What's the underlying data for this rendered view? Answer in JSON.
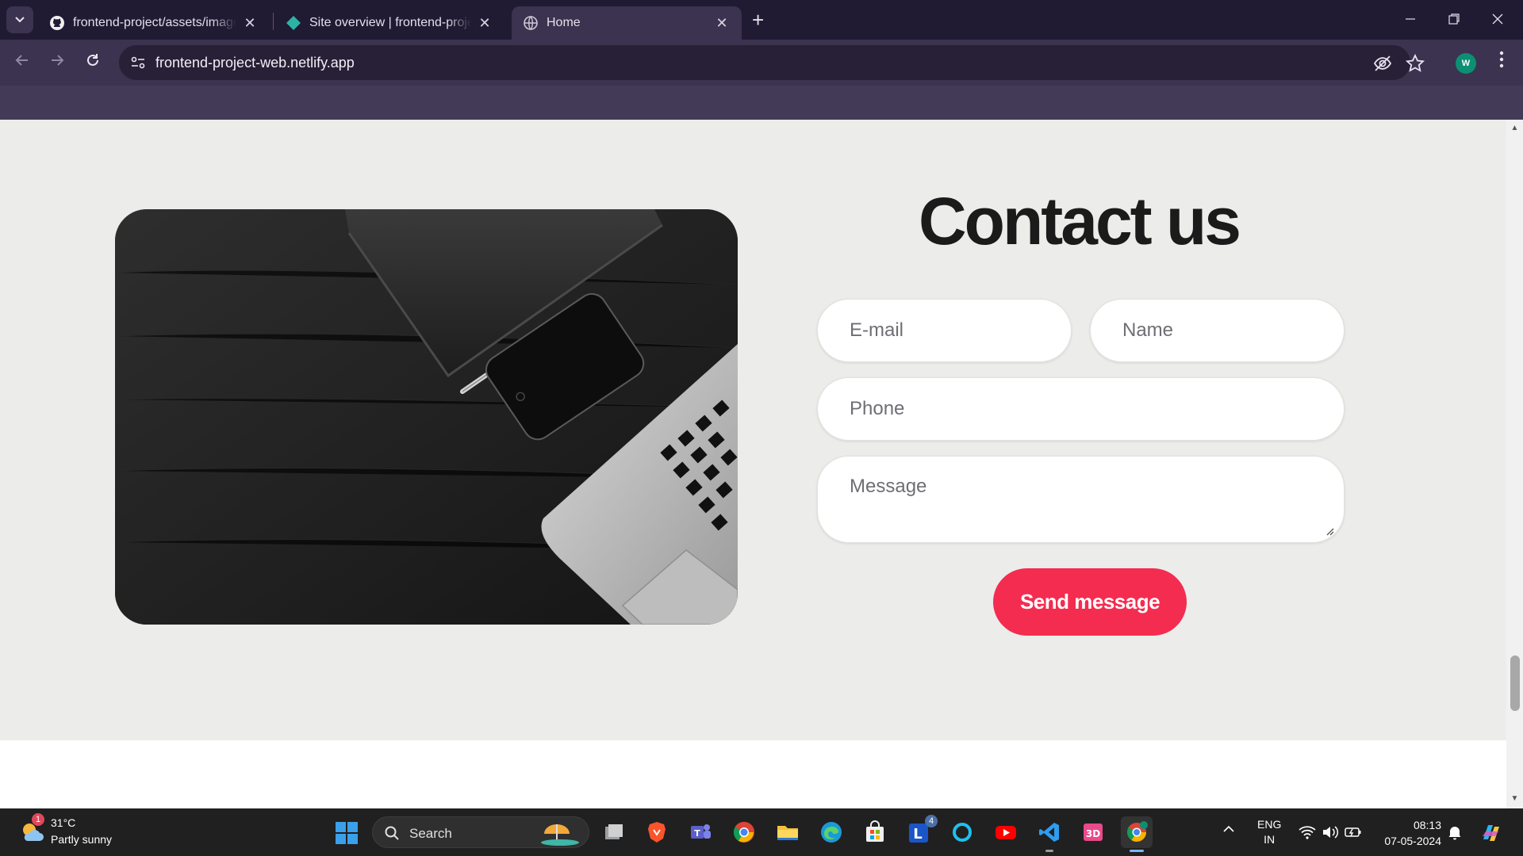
{
  "browser": {
    "tabs": [
      {
        "title": "frontend-project/assets/images",
        "active": false
      },
      {
        "title": "Site overview | frontend-project",
        "active": false
      },
      {
        "title": "Home",
        "active": true
      }
    ],
    "url": "frontend-project-web.netlify.app",
    "profile_initial": "W"
  },
  "page": {
    "contact": {
      "title": "Contact us",
      "email_placeholder": "E-mail",
      "name_placeholder": "Name",
      "phone_placeholder": "Phone",
      "message_placeholder": "Message",
      "send_label": "Send message"
    }
  },
  "taskbar": {
    "weather": {
      "temp": "31°C",
      "desc": "Partly sunny",
      "badge": "1"
    },
    "search_label": "Search",
    "lang_line1": "ENG",
    "lang_line2": "IN",
    "time": "08:13",
    "date": "07-05-2024",
    "outlook_badge": "4",
    "apps": [
      "file-explorer-task-view",
      "brave",
      "teams",
      "chrome",
      "file-explorer",
      "edge",
      "microsoft-store",
      "outlook-l",
      "cortana",
      "youtube",
      "vscode",
      "3d-app",
      "chrome-profile"
    ]
  },
  "colors": {
    "accent": "#f42c50",
    "page_bg": "#ecedea",
    "chrome_dark": "#201a33",
    "chrome_mid": "#3b3350"
  }
}
